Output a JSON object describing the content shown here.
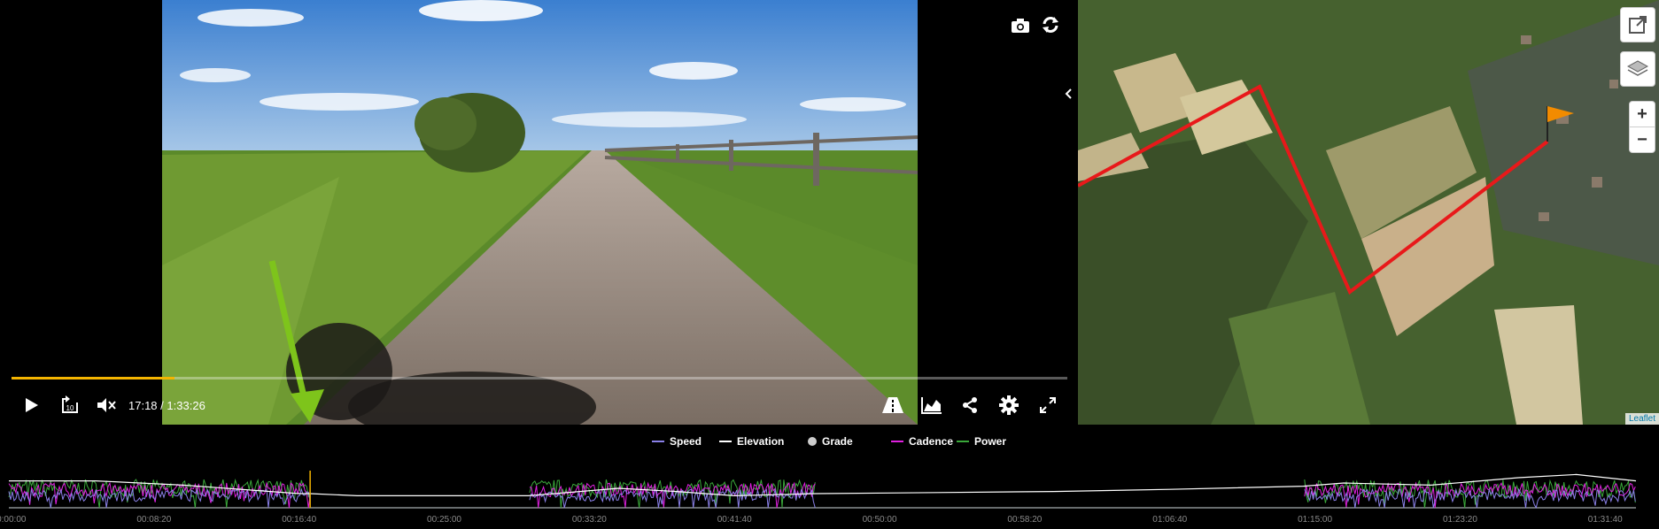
{
  "video": {
    "time_current": "17:18",
    "time_separator": "/",
    "time_total": "1:33:26",
    "progress_fraction": 0.154,
    "controls": {
      "play": "play-icon",
      "rewind": "rewind-10-icon",
      "rewind_label": "10",
      "mute": "volume-muted-icon",
      "road": "road-icon",
      "chart": "area-chart-icon",
      "share": "share-icon",
      "settings": "gear-icon",
      "fullscreen": "fullscreen-icon",
      "camera": "camera-icon",
      "sync": "sync-icon"
    },
    "accent_color": "#f4b400",
    "annotation_arrow_color": "#7ec41b"
  },
  "map": {
    "zoom_in": "+",
    "zoom_out": "−",
    "attribution": "Leaflet",
    "route_color": "#e8191a",
    "flag_color": "#f28b00"
  },
  "chart_data": {
    "type": "line",
    "legend": [
      {
        "name": "Speed",
        "color": "#8a80e8"
      },
      {
        "name": "Elevation",
        "color": "#ffffff"
      },
      {
        "name": "Grade",
        "color": "#cccccc"
      },
      {
        "name": "Cadence",
        "color": "#e020e0"
      },
      {
        "name": "Power",
        "color": "#3aa83a"
      }
    ],
    "x_ticks": [
      "00:00:00",
      "00:08:20",
      "00:16:40",
      "00:25:00",
      "00:33:20",
      "00:41:40",
      "00:50:00",
      "00:58:20",
      "01:06:40",
      "01:15:00",
      "01:23:20",
      "01:31:40"
    ],
    "x_range_seconds": [
      0,
      5606
    ],
    "cursor_seconds": 1038,
    "gaps_seconds": [
      [
        1038,
        1790
      ],
      [
        2780,
        4460
      ]
    ],
    "elevation": [
      [
        0,
        22
      ],
      [
        300,
        22
      ],
      [
        600,
        18
      ],
      [
        1000,
        10
      ],
      [
        1038,
        10
      ],
      [
        1200,
        8
      ],
      [
        1790,
        8
      ],
      [
        2100,
        15
      ],
      [
        2300,
        12
      ],
      [
        2500,
        8
      ],
      [
        2780,
        10
      ],
      [
        3200,
        11
      ],
      [
        3600,
        12
      ],
      [
        4000,
        14
      ],
      [
        4460,
        17
      ],
      [
        4600,
        20
      ],
      [
        4900,
        18
      ],
      [
        5200,
        25
      ],
      [
        5400,
        28
      ],
      [
        5606,
        22
      ]
    ]
  }
}
